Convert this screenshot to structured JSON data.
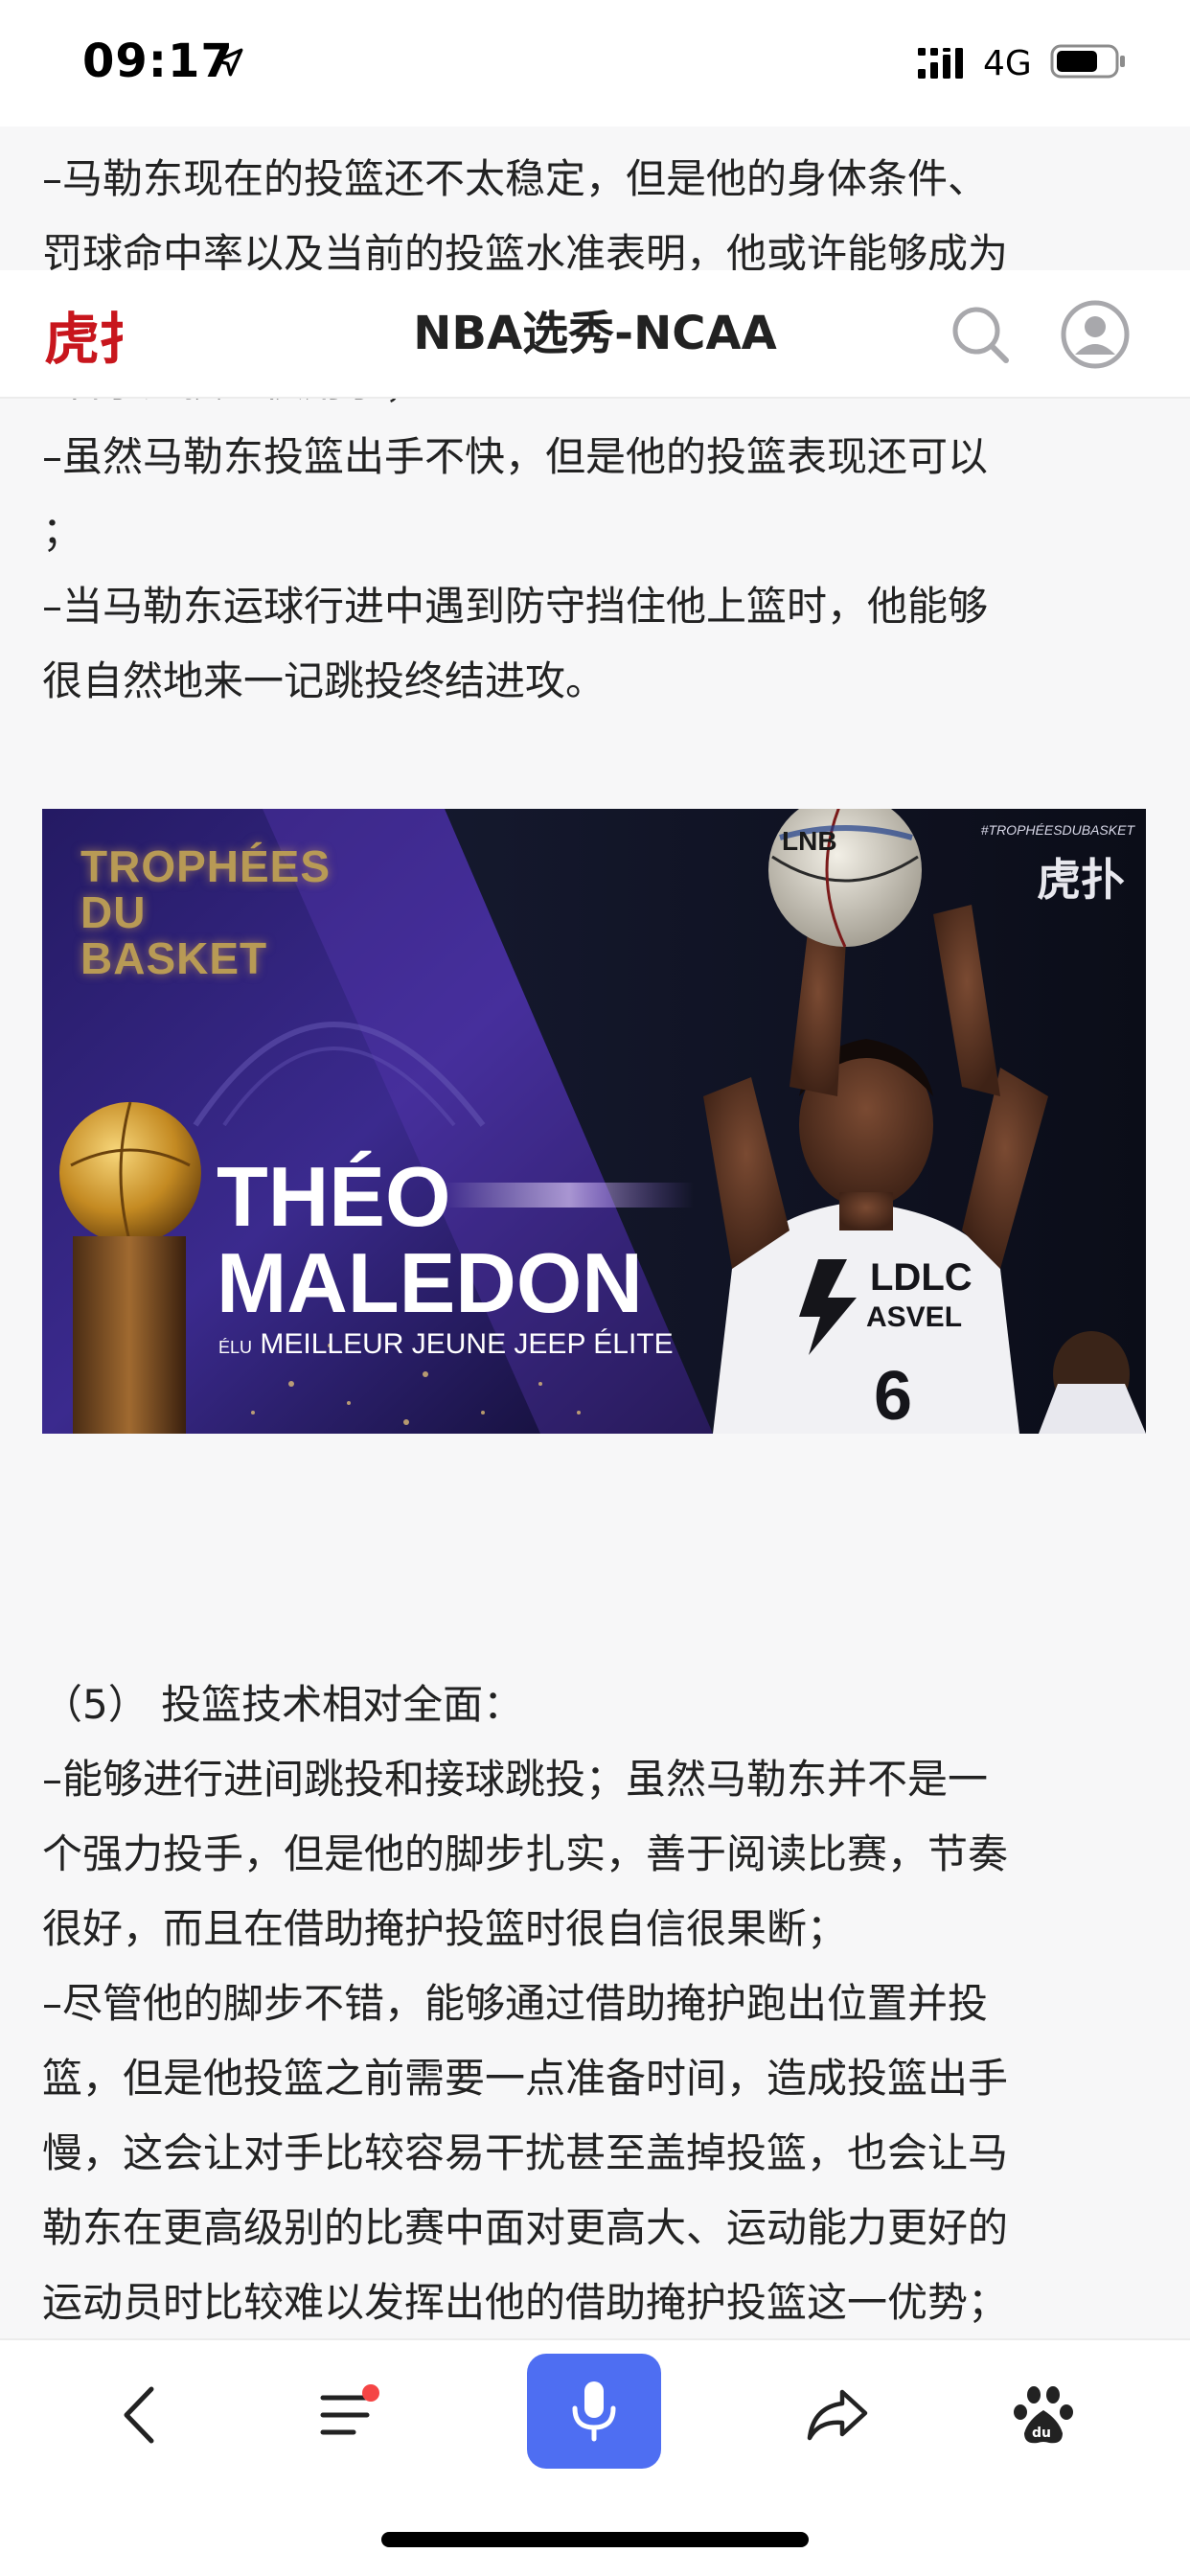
{
  "status_bar": {
    "time": "09:17",
    "network": "4G"
  },
  "header": {
    "title": "NBA选秀-NCAA",
    "logo_text": "虎扑"
  },
  "article": {
    "paragraphs_top": [
      "–马勒东现在的投篮还不太稳定，但是他的身体条件、",
      "罚球命中率以及当前的投篮水准表明，他或许能够成为",
      "–右手是投篮惯用手；",
      "–虽然马勒东投篮出手不快，但是他的投篮表现还可以",
      "；",
      "–当马勒东运球行进中遇到防守挡住他上篮时，他能够",
      "很自然地来一记跳投终结进攻。"
    ],
    "section_heading": "（5）   投篮技术相对全面：",
    "paragraphs_bottom": [
      "–能够进行进间跳投和接球跳投；虽然马勒东并不是一",
      "个强力投手，但是他的脚步扎实，善于阅读比赛，节奏",
      "很好，而且在借助掩护投篮时很自信很果断；",
      "–尽管他的脚步不错，能够通过借助掩护跑出位置并投",
      "篮，但是他投篮之前需要一点准备时间，造成投篮出手",
      "慢，这会让对手比较容易干扰甚至盖掉投篮，也会让马",
      "勒东在更高级别的比赛中面对更高大、运动能力更好的",
      "运动员时比较难以发挥出他的借助掩护投篮这一优势；"
    ]
  },
  "image": {
    "trophy_title": "TROPHÉES DU BASKET",
    "player_name_line1": "THÉO",
    "player_name_line2": "MALEDON",
    "award_prefix": "ÉLU",
    "award_text": "MEILLEUR JEUNE JEEP ÉLITE",
    "hashtag": "#TROPHÉESDUBASKET",
    "corner_logo": "虎扑",
    "ball_label": "LNB",
    "jersey_line1": "LDLC",
    "jersey_line2": "ASVEL",
    "jersey_number": "6"
  },
  "bottom_nav": {
    "items": [
      "back-icon",
      "menu-icon",
      "microphone-icon",
      "share-icon",
      "baidu-paw-icon"
    ],
    "accent_color": "#4e6ef2",
    "badge_color": "#f54545"
  },
  "colors": {
    "logo_red": "#c8161d",
    "text": "#222222",
    "background": "#f7f7f8"
  }
}
